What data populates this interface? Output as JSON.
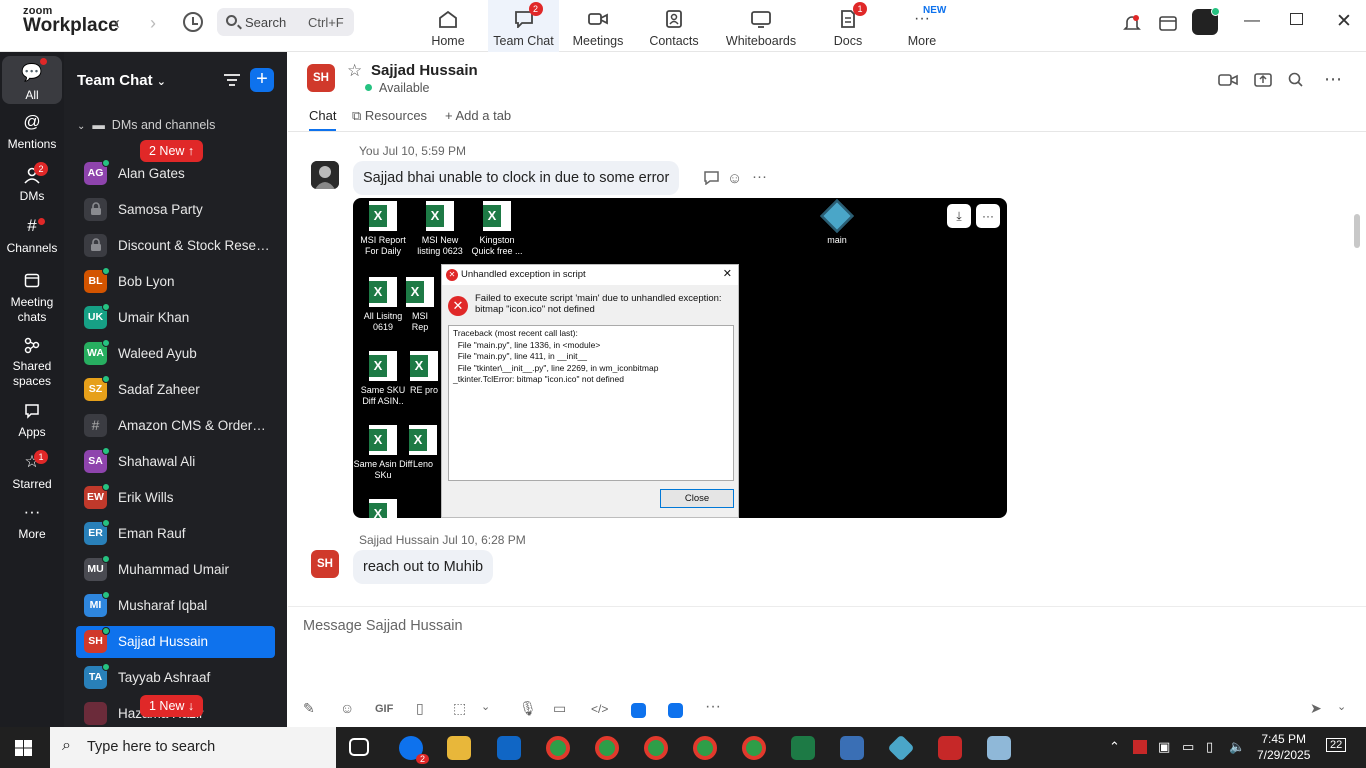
{
  "brand": {
    "line1": "zoom",
    "line2": "Workplace"
  },
  "search": {
    "label": "Search",
    "shortcut": "Ctrl+F"
  },
  "nav_tabs": [
    {
      "label": "Home",
      "icon": "home-icon"
    },
    {
      "label": "Team Chat",
      "icon": "chat-icon",
      "badge": "2"
    },
    {
      "label": "Meetings",
      "icon": "video-icon"
    },
    {
      "label": "Contacts",
      "icon": "contacts-icon"
    },
    {
      "label": "Whiteboards",
      "icon": "whiteboard-icon"
    },
    {
      "label": "Docs",
      "icon": "docs-icon",
      "badge": "1"
    },
    {
      "label": "More",
      "icon": "more-icon",
      "tag": "NEW"
    }
  ],
  "rail": [
    {
      "label": "All",
      "icon": "chat-bubble-icon"
    },
    {
      "label": "Mentions",
      "icon": "at-icon"
    },
    {
      "label": "DMs",
      "icon": "people-icon",
      "badge": "2"
    },
    {
      "label": "Channels",
      "icon": "hash-icon"
    },
    {
      "label": "Meeting chats",
      "icon": "calendar-icon"
    },
    {
      "label": "Shared spaces",
      "icon": "share-icon"
    },
    {
      "label": "Apps",
      "icon": "apps-icon"
    },
    {
      "label": "Starred",
      "icon": "star-icon",
      "badge": "1"
    },
    {
      "label": "More",
      "icon": "ellipsis-icon"
    }
  ],
  "sidebar": {
    "title": "Team Chat",
    "group": "DMs and channels",
    "new_top": "2 New ↑",
    "new_bottom": "1 New ↓",
    "contacts": [
      {
        "initials": "AG",
        "name": "Alan Gates",
        "color": "#8e44ad"
      },
      {
        "initials": "",
        "name": "Samosa Party",
        "color": "#3b3c42",
        "lock": true
      },
      {
        "initials": "",
        "name": "Discount & Stock Reser...",
        "color": "#3b3c42",
        "lock": true
      },
      {
        "initials": "BL",
        "name": "Bob Lyon",
        "color": "#d35400"
      },
      {
        "initials": "UK",
        "name": "Umair Khan",
        "color": "#16a085"
      },
      {
        "initials": "WA",
        "name": "Waleed Ayub",
        "color": "#27ae60"
      },
      {
        "initials": "SZ",
        "name": "Sadaf Zaheer",
        "color": "#e6a01a"
      },
      {
        "initials": "#",
        "name": "Amazon CMS & OrderA...",
        "color": "#3b3c42",
        "hash": true
      },
      {
        "initials": "SA",
        "name": "Shahawal Ali",
        "color": "#8e44ad"
      },
      {
        "initials": "EW",
        "name": "Erik Wills",
        "color": "#c0392b"
      },
      {
        "initials": "ER",
        "name": "Eman Rauf",
        "color": "#2980b9"
      },
      {
        "initials": "MU",
        "name": "Muhammad Umair",
        "color": "#4a4b52"
      },
      {
        "initials": "MI",
        "name": "Musharaf Iqbal",
        "color": "#2e86de"
      },
      {
        "initials": "SH",
        "name": "Sajjad Hussain",
        "color": "#d0392b",
        "selected": true
      },
      {
        "initials": "TA",
        "name": "Tayyab Ashraaf",
        "color": "#2980b9"
      },
      {
        "initials": "",
        "name": "Hazama Hazir",
        "color": "#6b2b3a"
      }
    ]
  },
  "chat": {
    "initials": "SH",
    "name": "Sajjad Hussain",
    "status": "Available",
    "tabs": [
      "Chat",
      "Resources",
      "Add a tab"
    ],
    "msg1_meta": "You Jul 10, 5:59 PM",
    "msg1_text": "Sajjad bhai unable to clock in due to some error",
    "msg2_meta": "Sajjad Hussain Jul 10, 6:28 PM",
    "msg2_text": "reach out to Muhib",
    "composer_placeholder": "Message Sajjad Hussain"
  },
  "attachment": {
    "desktop_icons": [
      {
        "label": "MSI Report For Daily"
      },
      {
        "label": "MSI New listing 0623"
      },
      {
        "label": "Kingston Quick free ..."
      },
      {
        "label": "All Lisitng 0619"
      },
      {
        "label": "MSI Rep"
      },
      {
        "label": "Same SKU Diff ASIN.."
      },
      {
        "label": "RE pro"
      },
      {
        "label": "Same Asin Diff SKu"
      },
      {
        "label": "Leno"
      }
    ],
    "main_icon_label": "main",
    "dialog_title": "Unhandled exception in script",
    "dialog_message": "Failed to execute script 'main' due to unhandled exception: bitmap \"icon.ico\" not defined",
    "traceback": "Traceback (most recent call last):\n  File \"main.py\", line 1336, in <module>\n  File \"main.py\", line 411, in __init__\n  File \"tkinter\\__init__.py\", line 2269, in wm_iconbitmap\n_tkinter.TclError: bitmap \"icon.ico\" not defined",
    "close_label": "Close"
  },
  "taskbar": {
    "search_placeholder": "Type here to search",
    "time": "7:45 PM",
    "date": "7/29/2025",
    "notifications": "22",
    "zoom_badge": "2"
  },
  "colors": {
    "accent": "#0e72ed",
    "badge": "#e02828",
    "online": "#26c281",
    "sidebar": "#1f2024",
    "rail": "#1c1d21"
  }
}
